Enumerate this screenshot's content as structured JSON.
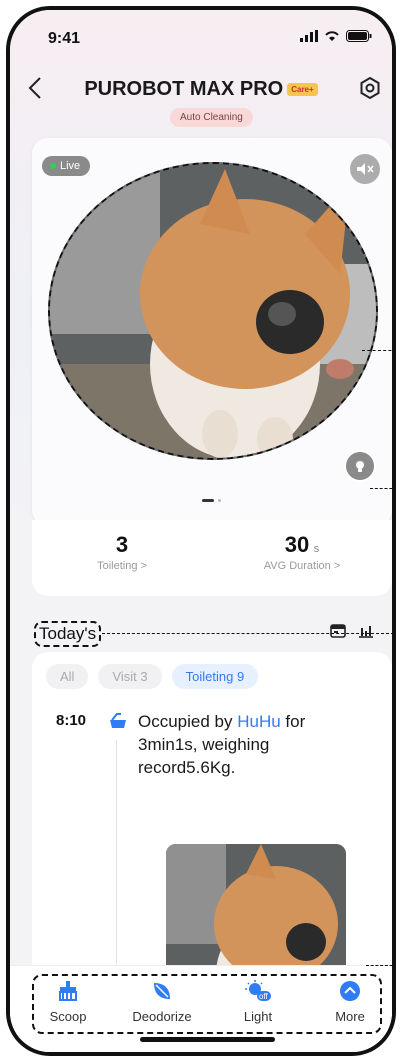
{
  "status_bar": {
    "time": "9:41"
  },
  "header": {
    "title": "PUROBOT MAX PRO",
    "badge": "Care+",
    "subtitle": "Auto Cleaning"
  },
  "camera": {
    "live_label": "Live"
  },
  "stats": {
    "toileting_count": "3",
    "toileting_label": "Toileting >",
    "avg_duration": "30",
    "avg_duration_unit": "s",
    "avg_duration_label": "AVG Duration >"
  },
  "today_label": "Today's",
  "filters": [
    {
      "label": "All"
    },
    {
      "label": "Visit",
      "count": "3"
    },
    {
      "label": "Toileting",
      "count": "9",
      "active": true
    }
  ],
  "events": [
    {
      "time": "8:10",
      "text_before": "Occupied by ",
      "cat_name": "HuHu",
      "text_after": " for 3min1s, weighing record5.6Kg."
    }
  ],
  "bottom_nav": [
    {
      "label": "Scoop",
      "icon": "scoop-icon"
    },
    {
      "label": "Deodorize",
      "icon": "leaf-icon"
    },
    {
      "label": "Light",
      "icon": "light-off-icon"
    },
    {
      "label": "More",
      "icon": "chevron-up-icon"
    }
  ],
  "colors": {
    "accent": "#2f7cf6",
    "live_dot": "#33d04f",
    "badge_bg": "#f6c64a"
  }
}
